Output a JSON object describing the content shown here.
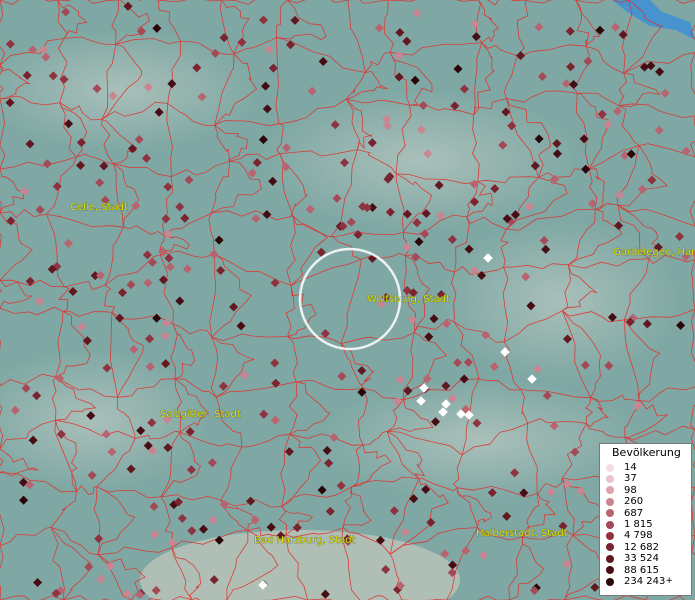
{
  "map": {
    "towns": [
      "Celle, Stadt",
      "Wolfsburg, Stadt",
      "Gardelegen, Han",
      "Salzgitter, Stadt",
      "Bad Harzburg, Stadt",
      "Halberstadt, Stadt"
    ]
  },
  "legend": {
    "title": "Bevölkerung",
    "classes": [
      {
        "label": "14",
        "color": "#f6dde2"
      },
      {
        "label": "37",
        "color": "#ecc2cb"
      },
      {
        "label": "98",
        "color": "#dca4ae"
      },
      {
        "label": "260",
        "color": "#c98591"
      },
      {
        "label": "687",
        "color": "#b86470"
      },
      {
        "label": "1 815",
        "color": "#a44a56"
      },
      {
        "label": "4 798",
        "color": "#8f3340"
      },
      {
        "label": "12 682",
        "color": "#7a2430"
      },
      {
        "label": "33 524",
        "color": "#611820"
      },
      {
        "label": "88 615",
        "color": "#460e14"
      },
      {
        "label": "234 243",
        "color": "#2a0608",
        "plus": "+"
      }
    ]
  },
  "colors": {
    "background": "#7fa8a4",
    "boundary": "#e0302c",
    "water": "#3c8fd8",
    "selection_ring": "#ffffff"
  }
}
